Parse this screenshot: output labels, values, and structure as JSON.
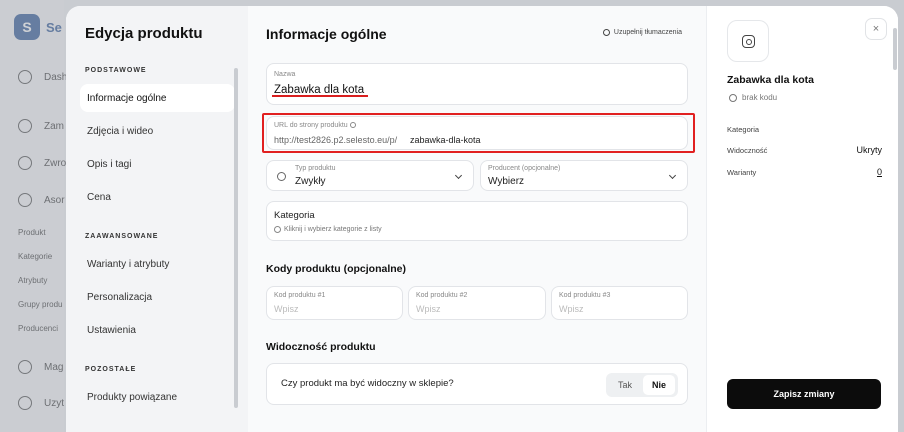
{
  "background": {
    "logo": "S",
    "app_name": "Se",
    "items": [
      "Dash",
      "Zam",
      "Zwro",
      "Asor",
      "Produkt",
      "Kategorie",
      "Atrybuty",
      "Grupy produ",
      "Producenci",
      "Mag",
      "Uzyt"
    ]
  },
  "nav": {
    "title": "Edycja produktu",
    "sections": {
      "basic": "PODSTAWOWE",
      "advanced": "ZAAWANSOWANE",
      "other": "POZOSTAŁE"
    },
    "items": [
      "Informacje ogólne",
      "Zdjęcia i wideo",
      "Opis i tagi",
      "Cena",
      "Warianty i atrybuty",
      "Personalizacja",
      "Ustawienia",
      "Produkty powiązane"
    ]
  },
  "main": {
    "title": "Informacje ogólne",
    "translate_label": "Uzupełnij tłumaczenia",
    "name": {
      "label": "Nazwa",
      "value": "Zabawka dla kota"
    },
    "url": {
      "label": "URL do strony produktu",
      "prefix": "http://test2826.p2.selesto.eu/p/",
      "slug": "zabawka-dla-kota"
    },
    "type": {
      "label": "Typ produktu",
      "value": "Zwykły"
    },
    "producer": {
      "label": "Producent (opcjonalne)",
      "value": "Wybierz"
    },
    "category": {
      "label": "Kategoria",
      "hint": "Kliknij i wybierz kategorie z listy"
    },
    "codes": {
      "title": "Kody produktu (opcjonalne)",
      "fields": [
        {
          "label": "Kod produktu #1",
          "placeholder": "Wpisz"
        },
        {
          "label": "Kod produktu #2",
          "placeholder": "Wpisz"
        },
        {
          "label": "Kod produktu #3",
          "placeholder": "Wpisz"
        }
      ]
    },
    "visibility": {
      "title": "Widoczność produktu",
      "question": "Czy produkt ma być widoczny w sklepie?",
      "yes": "Tak",
      "no": "Nie"
    }
  },
  "side": {
    "product_name": "Zabawka dla kota",
    "code": "brak kodu",
    "category_label": "Kategoria",
    "visibility_label": "Widoczność",
    "visibility_value": "Ukryty",
    "variants_label": "Warianty",
    "variants_value": "0",
    "save_label": "Zapisz zmiany",
    "close_symbol": "×"
  },
  "colors": {
    "highlight": "#e12020",
    "primary_button": "#0c0c0c"
  }
}
